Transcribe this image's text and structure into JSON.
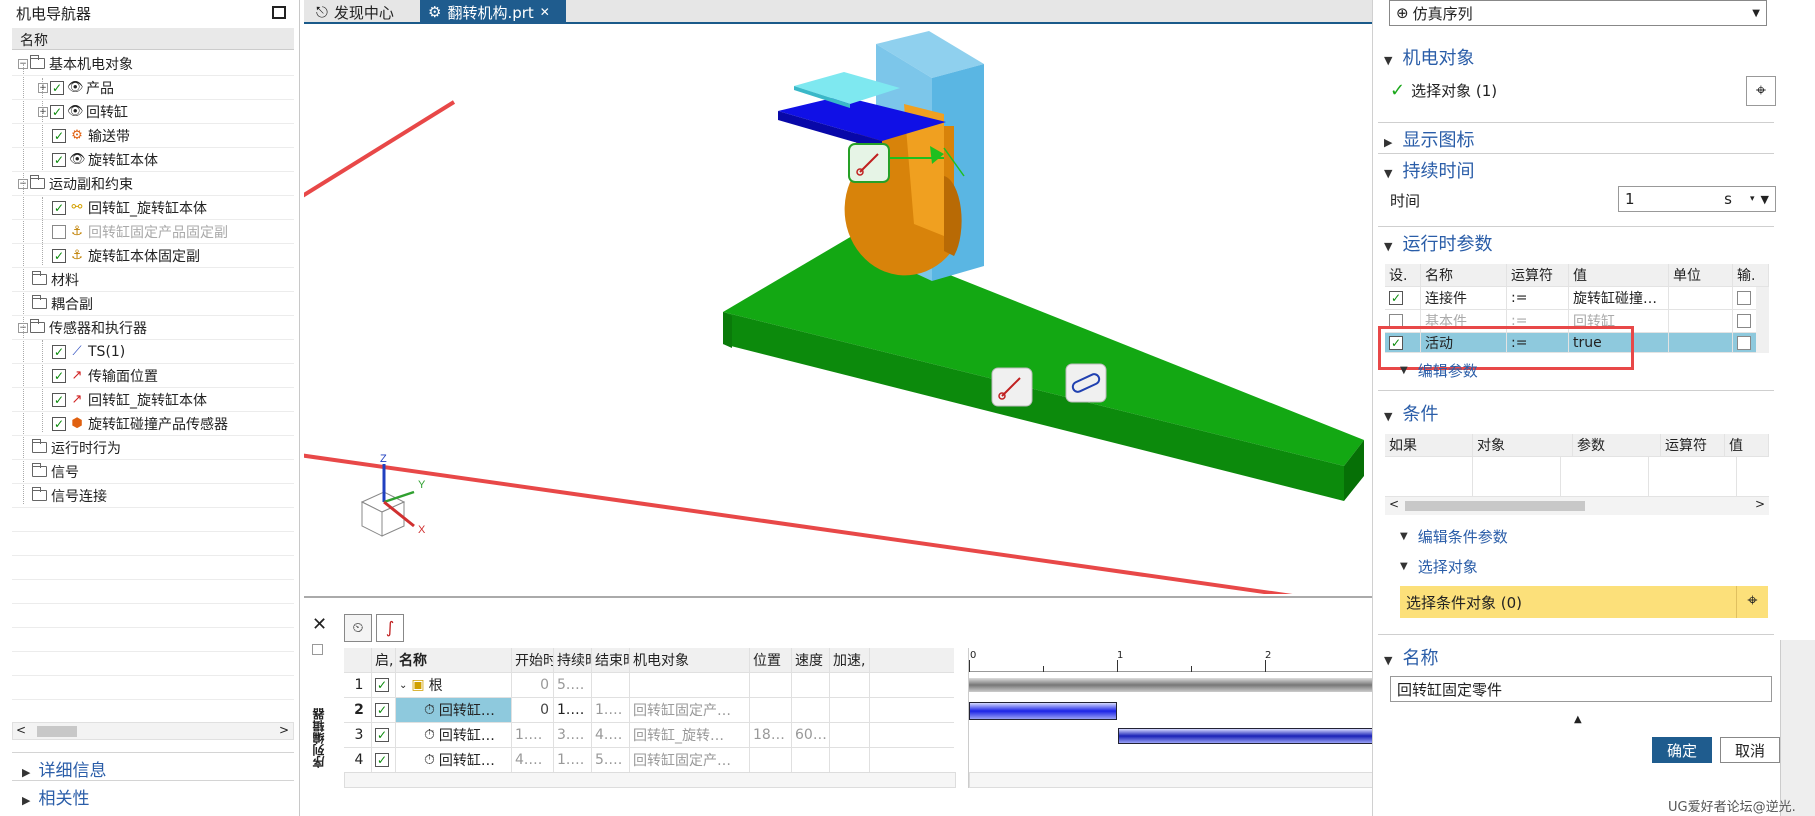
{
  "navigator": {
    "title": "机电导航器",
    "column": "名称",
    "tree": [
      {
        "label": "基本机电对象"
      },
      {
        "label": "产品"
      },
      {
        "label": "回转缸"
      },
      {
        "label": "输送带"
      },
      {
        "label": "旋转缸本体"
      },
      {
        "label": "运动副和约束"
      },
      {
        "label": "回转缸_旋转缸本体"
      },
      {
        "label": "回转缸固定产品固定副"
      },
      {
        "label": "旋转缸本体固定副"
      },
      {
        "label": "材料"
      },
      {
        "label": "耦合副"
      },
      {
        "label": "传感器和执行器"
      },
      {
        "label": "TS(1)"
      },
      {
        "label": "传输面位置"
      },
      {
        "label": "回转缸_旋转缸本体"
      },
      {
        "label": "旋转缸碰撞产品传感器"
      },
      {
        "label": "运行时行为"
      },
      {
        "label": "信号"
      },
      {
        "label": "信号连接"
      }
    ],
    "sections": [
      "详细信息",
      "相关性"
    ]
  },
  "tabs": [
    {
      "label": "发现中心"
    },
    {
      "label": "翻转机构.prt"
    }
  ],
  "sequence": {
    "side_label": "序列编辑器",
    "headers": [
      "启,",
      "名称",
      "开始时",
      "持续时",
      "结束时",
      "机电对象",
      "位置",
      "速度",
      "加速,"
    ],
    "rows": [
      {
        "num": "1",
        "name": "根",
        "start": "0",
        "dur": "5.…",
        "end": "",
        "obj": "",
        "pos": "",
        "speed": ""
      },
      {
        "num": "2",
        "name": "回转缸…",
        "start": "0",
        "dur": "1.…",
        "end": "1.…",
        "obj": "回转缸固定产…",
        "pos": "",
        "speed": ""
      },
      {
        "num": "3",
        "name": "回转缸…",
        "start": "1.…",
        "dur": "3.…",
        "end": "4.…",
        "obj": "回转缸_旋转…",
        "pos": "18…",
        "speed": "60…"
      },
      {
        "num": "4",
        "name": "回转缸…",
        "start": "4.…",
        "dur": "1.…",
        "end": "5.…",
        "obj": "回转缸固定产…",
        "pos": "",
        "speed": ""
      }
    ],
    "timeline_ticks": [
      "0",
      "1",
      "2"
    ]
  },
  "panel": {
    "dropdown": "仿真序列",
    "s_mech": "机电对象",
    "select_object": "选择对象 (1)",
    "s_icon": "显示图标",
    "s_duration": "持续时间",
    "time_label": "时间",
    "time_value": "1",
    "time_unit": "s",
    "s_runtime": "运行时参数",
    "rt_headers": [
      "设.",
      "名称",
      "运算符",
      "值",
      "单位",
      "输."
    ],
    "rt_rows": [
      {
        "name": "连接件",
        "op": ":=",
        "val": "旋转缸碰撞…"
      },
      {
        "name": "基本件",
        "op": ":=",
        "val": "回转缸"
      },
      {
        "name": "活动",
        "op": ":=",
        "val": "true"
      }
    ],
    "edit_params": "编辑参数",
    "s_condition": "条件",
    "cond_headers": [
      "如果",
      "对象",
      "参数",
      "运算符",
      "值"
    ],
    "edit_cond": "编辑条件参数",
    "sub_select": "选择对象",
    "select_cond": "选择条件对象 (0)",
    "s_name": "名称",
    "name_value": "回转缸固定零件",
    "ok": "确定",
    "cancel": "取消"
  },
  "watermark": "UG爱好者论坛@逆光.",
  "axes": {
    "z": "Z",
    "y": "Y",
    "x": "X"
  }
}
